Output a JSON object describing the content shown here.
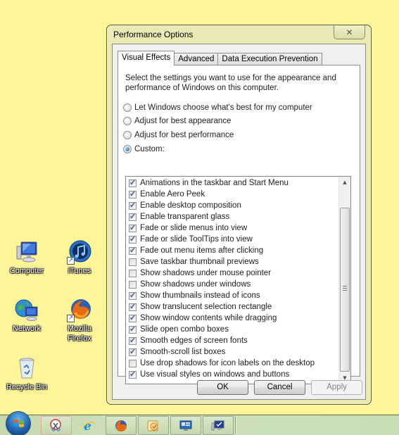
{
  "desktop": {
    "icons": [
      {
        "label": "Computer",
        "icon": "computer-icon"
      },
      {
        "label": "iTunes",
        "icon": "itunes-icon"
      },
      {
        "label": "Network",
        "icon": "network-icon"
      },
      {
        "label": "Mozilla\nFirefox",
        "line1": "Mozilla",
        "line2": "Firefox",
        "icon": "firefox-icon"
      },
      {
        "label": "Recycle Bin",
        "icon": "recycle-bin-icon"
      }
    ],
    "background_color": "#fdf598"
  },
  "dialog": {
    "title": "Performance Options",
    "close_glyph": "✕",
    "tabs": [
      {
        "label": "Visual Effects",
        "active": true
      },
      {
        "label": "Advanced",
        "active": false
      },
      {
        "label": "Data Execution Prevention",
        "active": false
      }
    ],
    "description": "Select the settings you want to use for the appearance and performance of Windows on this computer.",
    "options": [
      {
        "label": "Let Windows choose what's best for my computer",
        "selected": false
      },
      {
        "label": "Adjust for best appearance",
        "selected": false
      },
      {
        "label": "Adjust for best performance",
        "selected": false
      },
      {
        "label": "Custom:",
        "selected": true
      }
    ],
    "effects": [
      {
        "label": "Animations in the taskbar and Start Menu",
        "checked": true
      },
      {
        "label": "Enable Aero Peek",
        "checked": true
      },
      {
        "label": "Enable desktop composition",
        "checked": true
      },
      {
        "label": "Enable transparent glass",
        "checked": true
      },
      {
        "label": "Fade or slide menus into view",
        "checked": true
      },
      {
        "label": "Fade or slide ToolTips into view",
        "checked": true
      },
      {
        "label": "Fade out menu items after clicking",
        "checked": true
      },
      {
        "label": "Save taskbar thumbnail previews",
        "checked": false
      },
      {
        "label": "Show shadows under mouse pointer",
        "checked": false
      },
      {
        "label": "Show shadows under windows",
        "checked": false
      },
      {
        "label": "Show thumbnails instead of icons",
        "checked": true
      },
      {
        "label": "Show translucent selection rectangle",
        "checked": true
      },
      {
        "label": "Show window contents while dragging",
        "checked": true
      },
      {
        "label": "Slide open combo boxes",
        "checked": true
      },
      {
        "label": "Smooth edges of screen fonts",
        "checked": true
      },
      {
        "label": "Smooth-scroll list boxes",
        "checked": true
      },
      {
        "label": "Use drop shadows for icon labels on the desktop",
        "checked": false
      },
      {
        "label": "Use visual styles on windows and buttons",
        "checked": true
      }
    ],
    "scroll": {
      "up_glyph": "▲",
      "down_glyph": "▼"
    },
    "buttons": {
      "ok": "OK",
      "cancel": "Cancel",
      "apply": "Apply"
    },
    "apply_enabled": false
  },
  "taskbar": {
    "items": [
      {
        "name": "snipping-tool-icon",
        "active": true
      },
      {
        "name": "internet-explorer-icon",
        "active": false
      },
      {
        "name": "firefox-icon",
        "active": false
      },
      {
        "name": "outlook-icon",
        "active": false
      },
      {
        "name": "remote-desktop-icon",
        "active": false
      },
      {
        "name": "system-properties-icon",
        "active": false
      }
    ]
  }
}
